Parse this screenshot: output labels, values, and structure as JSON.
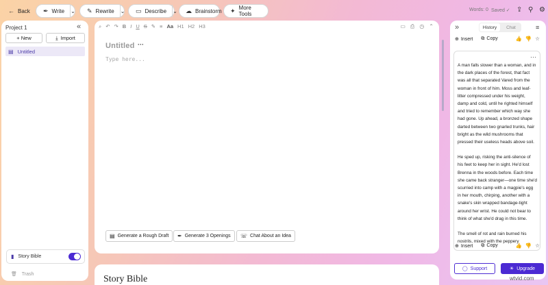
{
  "topbar": {
    "back": "Back",
    "write": "Write",
    "rewrite": "Rewrite",
    "describe": "Describe",
    "brainstorm": "Brainstorm",
    "more_tools": "More Tools",
    "words": "Words: 0",
    "saved": "Saved ✓"
  },
  "sidebar": {
    "project": "Project 1",
    "new": "+ New",
    "import": "Import",
    "doc": "Untitled",
    "story_bible": "Story Bible",
    "story_bible_enabled": true,
    "trash": "Trash"
  },
  "editor": {
    "title": "Untitled",
    "placeholder": "Type here...",
    "toolbar": [
      "⌕",
      "↶",
      "↷",
      "B",
      "I",
      "U",
      "S",
      "✎",
      "≡",
      "Aa",
      "H1",
      "H2",
      "H3"
    ],
    "chips": {
      "rough_draft": "Generate a Rough Draft",
      "openings": "Generate 3 Openings",
      "chat_idea": "Chat About an Idea"
    }
  },
  "bible": {
    "title": "Story Bible"
  },
  "right_panel": {
    "tabs": [
      "History",
      "Chat"
    ],
    "active_tab": "History",
    "insert": "Insert",
    "copy": "Copy",
    "paragraphs": [
      "A man falls slower than a woman, and in the dark places of the forest, that fact was all that separated Vared from the woman in front of him. Moss and leaf-litter compressed under his weight, damp and cold, until he righted himself and tried to remember which way she had gone. Up ahead, a bronzed shape darted between two gnarled trunks, hair bright as the wild mushrooms that pressed their useless heads above soil.",
      "He sped up, risking the anti-silence of his feet to keep her in sight. He'd lost Brenna in the woods before. Each time she came back stranger—one time she'd scurried into camp with a magpie's egg in her mouth, chirping, another with a snake's skin wrapped bandage-tight around her wrist. He could not bear to think of what she'd drag in this time.",
      "The smell of rot and rain burned his nostrils, mixed with the peppery sweetness of woodsm"
    ],
    "support": "Support",
    "upgrade": "Upgrade"
  },
  "watermark": "wtvid.com"
}
